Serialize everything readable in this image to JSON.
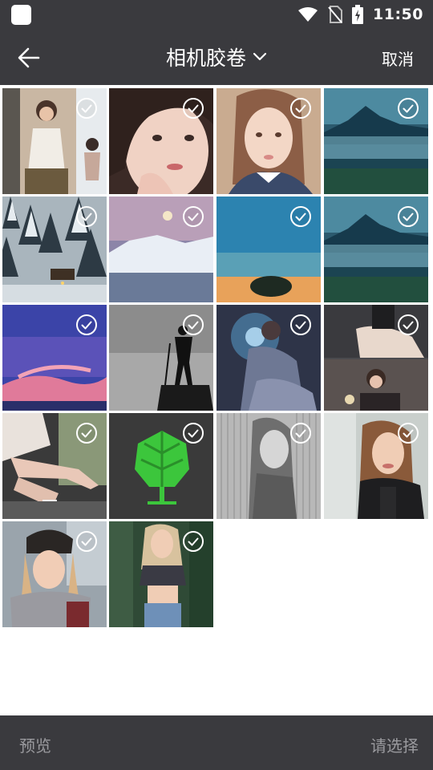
{
  "status_bar": {
    "time": "11:50",
    "icons": [
      "app-icon",
      "wifi-icon",
      "no-sim-icon",
      "battery-charging-icon"
    ]
  },
  "toolbar": {
    "back_icon": "arrow-left-icon",
    "title": "相机胶卷",
    "dropdown_icon": "chevron-down-icon",
    "cancel_label": "取消"
  },
  "photos": [
    {
      "subject": "girl-collage",
      "selected": false
    },
    {
      "subject": "girl-closeup",
      "selected": false
    },
    {
      "subject": "girl-portrait",
      "selected": false
    },
    {
      "subject": "mountain-lake",
      "selected": false
    },
    {
      "subject": "snowy-forest",
      "selected": false
    },
    {
      "subject": "snow-mountain-moon",
      "selected": false
    },
    {
      "subject": "lone-tree-sunset",
      "selected": false
    },
    {
      "subject": "mountain-lake",
      "selected": false
    },
    {
      "subject": "purple-sky",
      "selected": false
    },
    {
      "subject": "hiker-silhouette",
      "selected": false
    },
    {
      "subject": "girl-phone-glow",
      "selected": false
    },
    {
      "subject": "girl-dress-collage",
      "selected": false
    },
    {
      "subject": "legs-sitting",
      "selected": false
    },
    {
      "subject": "green-tree-logo",
      "selected": false
    },
    {
      "subject": "sketch-portrait",
      "selected": false
    },
    {
      "subject": "woman-leather-jacket",
      "selected": false
    },
    {
      "subject": "woman-beanie",
      "selected": false
    },
    {
      "subject": "woman-crop-top",
      "selected": false
    }
  ],
  "bottom_bar": {
    "preview_label": "预览",
    "select_label": "请选择"
  },
  "colors": {
    "bar_background": "#3a3a3e",
    "disabled_text": "#9a9a9e",
    "title_text": "#ffffff"
  }
}
